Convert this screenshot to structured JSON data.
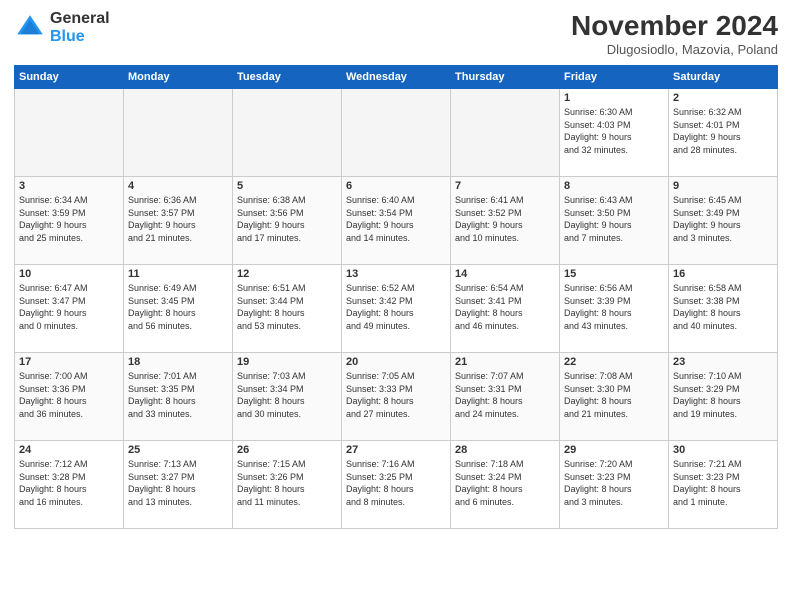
{
  "logo": {
    "general": "General",
    "blue": "Blue"
  },
  "title": "November 2024",
  "location": "Dlugosiodlo, Mazovia, Poland",
  "weekdays": [
    "Sunday",
    "Monday",
    "Tuesday",
    "Wednesday",
    "Thursday",
    "Friday",
    "Saturday"
  ],
  "weeks": [
    [
      {
        "day": "",
        "info": ""
      },
      {
        "day": "",
        "info": ""
      },
      {
        "day": "",
        "info": ""
      },
      {
        "day": "",
        "info": ""
      },
      {
        "day": "",
        "info": ""
      },
      {
        "day": "1",
        "info": "Sunrise: 6:30 AM\nSunset: 4:03 PM\nDaylight: 9 hours\nand 32 minutes."
      },
      {
        "day": "2",
        "info": "Sunrise: 6:32 AM\nSunset: 4:01 PM\nDaylight: 9 hours\nand 28 minutes."
      }
    ],
    [
      {
        "day": "3",
        "info": "Sunrise: 6:34 AM\nSunset: 3:59 PM\nDaylight: 9 hours\nand 25 minutes."
      },
      {
        "day": "4",
        "info": "Sunrise: 6:36 AM\nSunset: 3:57 PM\nDaylight: 9 hours\nand 21 minutes."
      },
      {
        "day": "5",
        "info": "Sunrise: 6:38 AM\nSunset: 3:56 PM\nDaylight: 9 hours\nand 17 minutes."
      },
      {
        "day": "6",
        "info": "Sunrise: 6:40 AM\nSunset: 3:54 PM\nDaylight: 9 hours\nand 14 minutes."
      },
      {
        "day": "7",
        "info": "Sunrise: 6:41 AM\nSunset: 3:52 PM\nDaylight: 9 hours\nand 10 minutes."
      },
      {
        "day": "8",
        "info": "Sunrise: 6:43 AM\nSunset: 3:50 PM\nDaylight: 9 hours\nand 7 minutes."
      },
      {
        "day": "9",
        "info": "Sunrise: 6:45 AM\nSunset: 3:49 PM\nDaylight: 9 hours\nand 3 minutes."
      }
    ],
    [
      {
        "day": "10",
        "info": "Sunrise: 6:47 AM\nSunset: 3:47 PM\nDaylight: 9 hours\nand 0 minutes."
      },
      {
        "day": "11",
        "info": "Sunrise: 6:49 AM\nSunset: 3:45 PM\nDaylight: 8 hours\nand 56 minutes."
      },
      {
        "day": "12",
        "info": "Sunrise: 6:51 AM\nSunset: 3:44 PM\nDaylight: 8 hours\nand 53 minutes."
      },
      {
        "day": "13",
        "info": "Sunrise: 6:52 AM\nSunset: 3:42 PM\nDaylight: 8 hours\nand 49 minutes."
      },
      {
        "day": "14",
        "info": "Sunrise: 6:54 AM\nSunset: 3:41 PM\nDaylight: 8 hours\nand 46 minutes."
      },
      {
        "day": "15",
        "info": "Sunrise: 6:56 AM\nSunset: 3:39 PM\nDaylight: 8 hours\nand 43 minutes."
      },
      {
        "day": "16",
        "info": "Sunrise: 6:58 AM\nSunset: 3:38 PM\nDaylight: 8 hours\nand 40 minutes."
      }
    ],
    [
      {
        "day": "17",
        "info": "Sunrise: 7:00 AM\nSunset: 3:36 PM\nDaylight: 8 hours\nand 36 minutes."
      },
      {
        "day": "18",
        "info": "Sunrise: 7:01 AM\nSunset: 3:35 PM\nDaylight: 8 hours\nand 33 minutes."
      },
      {
        "day": "19",
        "info": "Sunrise: 7:03 AM\nSunset: 3:34 PM\nDaylight: 8 hours\nand 30 minutes."
      },
      {
        "day": "20",
        "info": "Sunrise: 7:05 AM\nSunset: 3:33 PM\nDaylight: 8 hours\nand 27 minutes."
      },
      {
        "day": "21",
        "info": "Sunrise: 7:07 AM\nSunset: 3:31 PM\nDaylight: 8 hours\nand 24 minutes."
      },
      {
        "day": "22",
        "info": "Sunrise: 7:08 AM\nSunset: 3:30 PM\nDaylight: 8 hours\nand 21 minutes."
      },
      {
        "day": "23",
        "info": "Sunrise: 7:10 AM\nSunset: 3:29 PM\nDaylight: 8 hours\nand 19 minutes."
      }
    ],
    [
      {
        "day": "24",
        "info": "Sunrise: 7:12 AM\nSunset: 3:28 PM\nDaylight: 8 hours\nand 16 minutes."
      },
      {
        "day": "25",
        "info": "Sunrise: 7:13 AM\nSunset: 3:27 PM\nDaylight: 8 hours\nand 13 minutes."
      },
      {
        "day": "26",
        "info": "Sunrise: 7:15 AM\nSunset: 3:26 PM\nDaylight: 8 hours\nand 11 minutes."
      },
      {
        "day": "27",
        "info": "Sunrise: 7:16 AM\nSunset: 3:25 PM\nDaylight: 8 hours\nand 8 minutes."
      },
      {
        "day": "28",
        "info": "Sunrise: 7:18 AM\nSunset: 3:24 PM\nDaylight: 8 hours\nand 6 minutes."
      },
      {
        "day": "29",
        "info": "Sunrise: 7:20 AM\nSunset: 3:23 PM\nDaylight: 8 hours\nand 3 minutes."
      },
      {
        "day": "30",
        "info": "Sunrise: 7:21 AM\nSunset: 3:23 PM\nDaylight: 8 hours\nand 1 minute."
      }
    ]
  ]
}
